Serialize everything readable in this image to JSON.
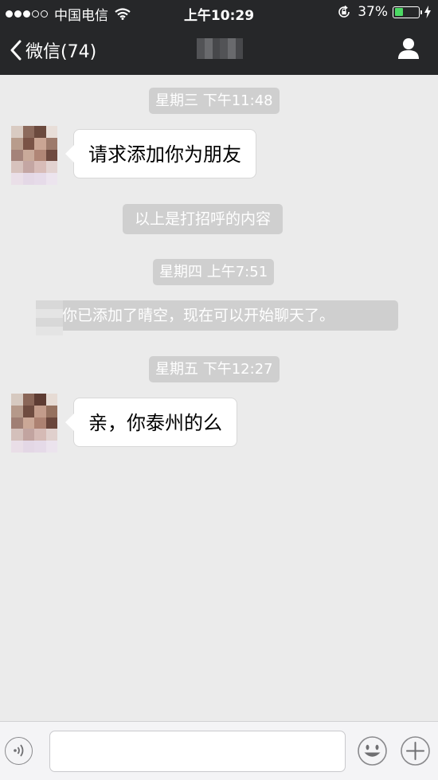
{
  "status_bar": {
    "signal_dots_filled": 3,
    "signal_dots_total": 5,
    "carrier": "中国电信",
    "time": "上午10:29",
    "battery_percent": "37%",
    "battery_level": 0.37,
    "battery_color": "#4cd964"
  },
  "nav": {
    "back_label": "微信(74)",
    "title": "",
    "profile_icon": "person-icon"
  },
  "messages": [
    {
      "kind": "timestamp",
      "text": "星期三 下午11:48"
    },
    {
      "kind": "incoming",
      "text": "请求添加你为朋友"
    },
    {
      "kind": "system",
      "text": "以上是打招呼的内容"
    },
    {
      "kind": "timestamp",
      "text": "星期四 上午7:51"
    },
    {
      "kind": "system",
      "text": "你已添加了晴空，现在可以开始聊天了。"
    },
    {
      "kind": "timestamp",
      "text": "星期五 下午12:27"
    },
    {
      "kind": "incoming",
      "text": "亲，你泰州的么"
    }
  ],
  "input_bar": {
    "voice_icon": "voice-icon",
    "input_value": "",
    "emoji_icon": "emoji-icon",
    "plus_icon": "plus-icon"
  },
  "colors": {
    "nav_background": "#262729",
    "chat_background": "#ebebeb",
    "timestamp_background": "#cfcfcf",
    "bubble_background": "#ffffff"
  }
}
